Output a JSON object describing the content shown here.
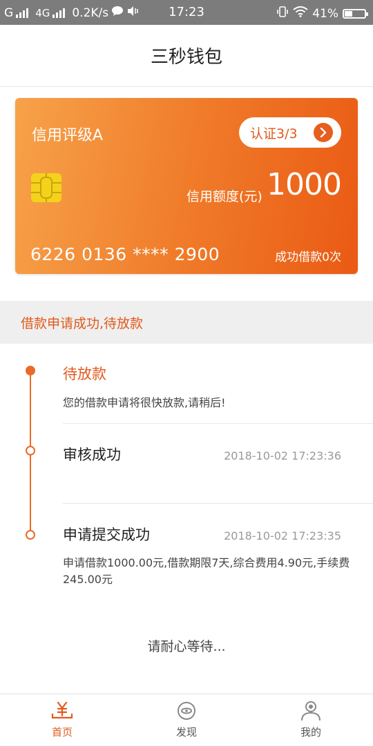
{
  "status_bar": {
    "carrier1": "G",
    "network": "4G",
    "speed": "0.2K/s",
    "time": "17:23",
    "battery": "41%"
  },
  "header": {
    "title": "三秒钱包"
  },
  "card": {
    "rating": "信用评级A",
    "auth_label": "认证3/3",
    "credit_label": "信用额度(元)",
    "credit_amount": "1000",
    "card_number": "6226 0136 **** 2900",
    "loan_count": "成功借款0次",
    "gradient_start": "#f7a24a",
    "gradient_end": "#ea5a14"
  },
  "notice": {
    "text": "借款申请成功,待放款"
  },
  "timeline": [
    {
      "title": "待放款",
      "desc": "您的借款申请将很快放款,请稍后!",
      "time": "",
      "active": true
    },
    {
      "title": "审核成功",
      "desc": "",
      "time": "2018-10-02 17:23:36",
      "active": false
    },
    {
      "title": "申请提交成功",
      "desc": "申请借款1000.00元,借款期限7天,综合费用4.90元,手续费245.00元",
      "time": "2018-10-02 17:23:35",
      "active": false
    }
  ],
  "wait_text": "请耐心等待...",
  "tabs": [
    {
      "label": "首页",
      "icon": "yen-home-icon",
      "active": true
    },
    {
      "label": "发现",
      "icon": "discover-eye-icon",
      "active": false
    },
    {
      "label": "我的",
      "icon": "user-profile-icon",
      "active": false
    }
  ],
  "colors": {
    "accent": "#e05a1c",
    "timeline": "#ea6a28"
  }
}
